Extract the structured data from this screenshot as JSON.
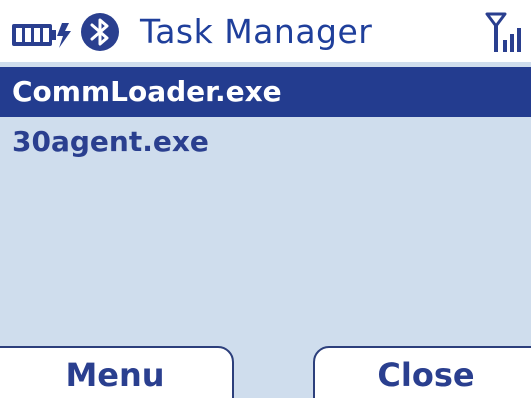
{
  "status_bar": {
    "title": "Task Manager",
    "battery_icon": "battery-icon",
    "bluetooth_icon": "bluetooth-icon",
    "signal_icon": "signal-strength-icon"
  },
  "task_list": {
    "items": [
      {
        "label": "CommLoader.exe",
        "selected": true
      },
      {
        "label": "30agent.exe",
        "selected": false
      }
    ]
  },
  "softkeys": {
    "left_label": "Menu",
    "right_label": "Close"
  },
  "colors": {
    "accent": "#233c8f",
    "background": "#cfdded",
    "title_text": "#1f3f9b"
  }
}
